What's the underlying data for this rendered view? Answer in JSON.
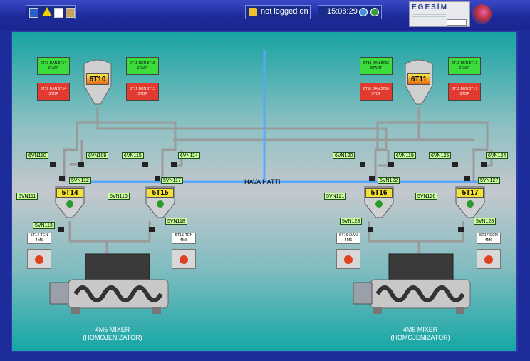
{
  "status": {
    "login": "not logged on",
    "time": "15:08:29"
  },
  "logo": {
    "text": "EGESİM"
  },
  "air_line": "HAVA HATTI",
  "silos": [
    {
      "id": "6T10",
      "start": [
        "6T10 DAN 5T14",
        "START"
      ],
      "stop": [
        "6T10 DAN 5T14",
        "STOP"
      ]
    },
    {
      "id": "6T11"
    }
  ],
  "buttons": [
    {
      "l1": "6T10 DAN 5T14",
      "l2": "START",
      "type": "start"
    },
    {
      "l1": "6T11 DEN 5T15",
      "l2": "START",
      "type": "start"
    },
    {
      "l1": "6T10 DAN 5T14",
      "l2": "STOP",
      "type": "stop"
    },
    {
      "l1": "6T11 DEN 5T15",
      "l2": "STOP",
      "type": "stop"
    },
    {
      "l1": "6T10 DAN 5T16",
      "l2": "START",
      "type": "start"
    },
    {
      "l1": "6T11 DEN 5T17",
      "l2": "START",
      "type": "start"
    },
    {
      "l1": "6T10 DAN 5T16",
      "l2": "STOP",
      "type": "stop"
    },
    {
      "l1": "6T11 DEN 5T17",
      "l2": "STOP",
      "type": "stop"
    }
  ],
  "tanks": [
    "5T14",
    "5T15",
    "5T16",
    "5T17"
  ],
  "valves": [
    "6VN110",
    "6VN109",
    "6VN115",
    "6VN114",
    "5VN112",
    "5VN117",
    "5VN111",
    "5VN116",
    "5VN113",
    "5VN118",
    "6VN120",
    "6VN119",
    "6VN125",
    "6VN124",
    "5VN122",
    "5VN127",
    "5VN121",
    "5VN126",
    "5VN123",
    "5VN128"
  ],
  "gates": [
    {
      "l1": "5T14 TEN",
      "l2": "4M5"
    },
    {
      "l1": "5T15 TEN",
      "l2": "4M5"
    },
    {
      "l1": "5T16 DAN",
      "l2": "4M6"
    },
    {
      "l1": "5T17 DEN",
      "l2": "4M6"
    }
  ],
  "mixers": [
    {
      "l1": "4M5 MIXER",
      "l2": "(HOMOJENIZATOR)"
    },
    {
      "l1": "4M6 MIXER",
      "l2": "(HOMOJENIZATOR)"
    }
  ],
  "colors": {
    "frame": "#1c2c9a",
    "start": "#3ddc3d",
    "stop": "#e23a2e",
    "valve_label": "#c8ff9a",
    "tank_label": "#f3e233"
  }
}
